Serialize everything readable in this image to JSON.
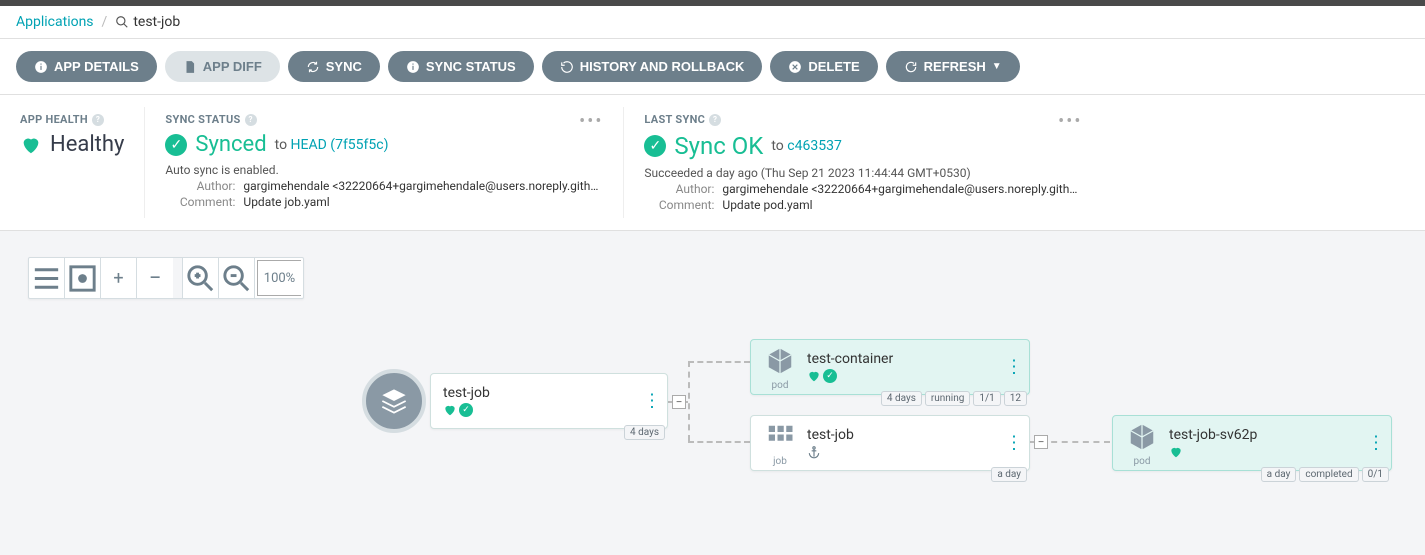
{
  "breadcrumb": {
    "root": "Applications",
    "current": "test-job"
  },
  "toolbar": {
    "details": "APP DETAILS",
    "diff": "APP DIFF",
    "sync": "SYNC",
    "sync_status": "SYNC STATUS",
    "history": "HISTORY AND ROLLBACK",
    "delete": "DELETE",
    "refresh": "REFRESH"
  },
  "health": {
    "label": "APP HEALTH",
    "status": "Healthy"
  },
  "sync_status": {
    "label": "SYNC STATUS",
    "status": "Synced",
    "to_text": "to",
    "rev": "HEAD (7f55f5c)",
    "auto_sync": "Auto sync is enabled.",
    "author_label": "Author:",
    "author": "gargimehendale <32220664+gargimehendale@users.noreply.github.com…",
    "comment_label": "Comment:",
    "comment": "Update job.yaml"
  },
  "last_sync": {
    "label": "LAST SYNC",
    "status": "Sync OK",
    "to_text": "to",
    "rev": "c463537",
    "succeeded": "Succeeded a day ago (Thu Sep 21 2023 11:44:44 GMT+0530)",
    "author_label": "Author:",
    "author": "gargimehendale <32220664+gargimehendale@users.noreply.github.com…",
    "comment_label": "Comment:",
    "comment": "Update pod.yaml"
  },
  "tree_controls": {
    "zoom": "100%"
  },
  "nodes": {
    "root": {
      "title": "test-job",
      "age": "4 days"
    },
    "container_pod": {
      "title": "test-container",
      "kind": "pod",
      "age": "4 days",
      "state": "running",
      "ready": "1/1",
      "restarts": "12"
    },
    "job": {
      "title": "test-job",
      "kind": "job",
      "age": "a day"
    },
    "job_pod": {
      "title": "test-job-sv62p",
      "kind": "pod",
      "age": "a day",
      "state": "completed",
      "ready": "0/1"
    }
  }
}
